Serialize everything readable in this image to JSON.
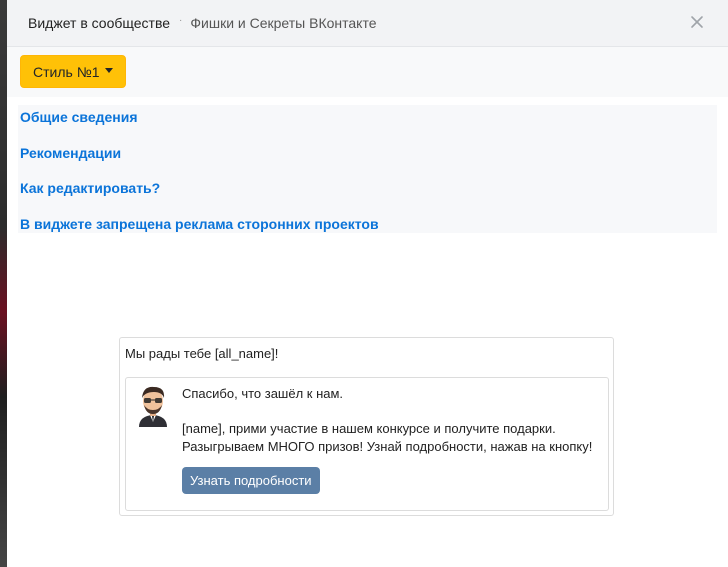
{
  "header": {
    "title": "Виджет в сообществе",
    "separator": "·",
    "subtitle": "Фишки и Секреты ВКонтакте",
    "close_icon": "close-icon"
  },
  "toolbar": {
    "style_button_label": "Стиль №1",
    "accent_color": "#ffc107"
  },
  "info_links": [
    "Общие сведения",
    "Рекомендации",
    "Как редактировать?",
    "В виджете запрещена реклама сторонних проектов"
  ],
  "widget": {
    "title": "Мы рады тебе [all_name]!",
    "avatar_icon": "avatar-icon",
    "greeting": "Спасибо, что зашёл к нам.",
    "line1": "[name], прими участие в нашем конкурсе и получите подарки.",
    "line2": "Разыгрываем МНОГО призов! Узнай подробности, нажав на кнопку!",
    "button_label": "Узнать подробности",
    "button_color": "#5b7fa6"
  },
  "colors": {
    "link": "#0b74d9",
    "header_bg": "#f2f3f5"
  }
}
